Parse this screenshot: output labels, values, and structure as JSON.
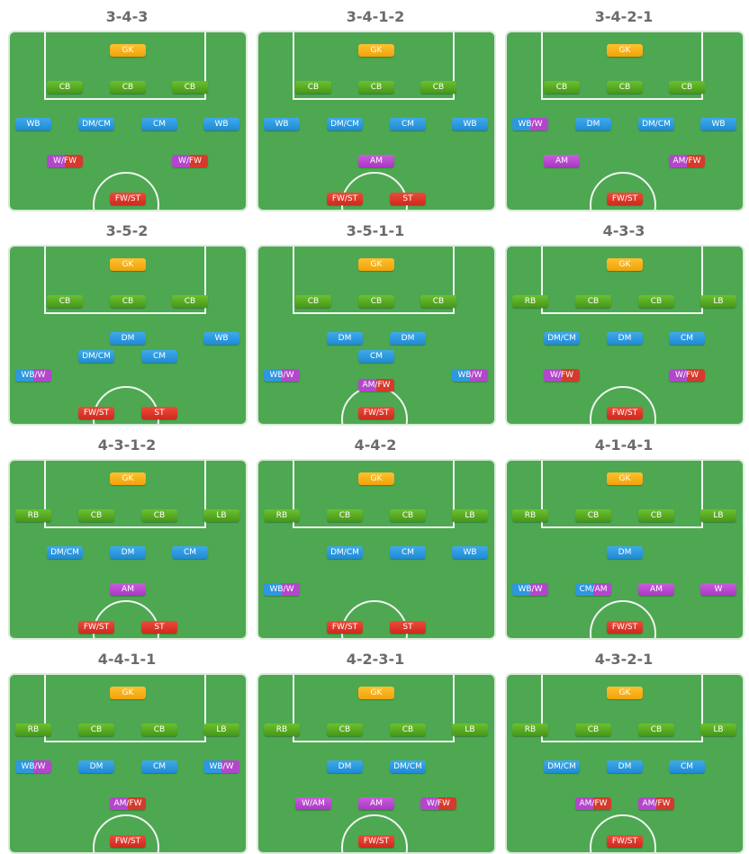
{
  "formations": [
    {
      "name": "3-4-3",
      "positions": [
        {
          "label": "GK",
          "role": "gk"
        },
        {
          "label": "CB",
          "role": "def"
        },
        {
          "label": "CB",
          "role": "def"
        },
        {
          "label": "CB",
          "role": "def"
        },
        {
          "label": "WB",
          "role": "mid"
        },
        {
          "label": "DM/CM",
          "role": "mid"
        },
        {
          "label": "CM",
          "role": "mid"
        },
        {
          "label": "WB",
          "role": "mid"
        },
        {
          "label": "W/FW",
          "role": "att-fwd"
        },
        {
          "label": "W/FW",
          "role": "att-fwd"
        },
        {
          "label": "FW/ST",
          "role": "fwd"
        }
      ]
    },
    {
      "name": "3-4-1-2",
      "positions": [
        {
          "label": "GK",
          "role": "gk"
        },
        {
          "label": "CB",
          "role": "def"
        },
        {
          "label": "CB",
          "role": "def"
        },
        {
          "label": "CB",
          "role": "def"
        },
        {
          "label": "WB",
          "role": "mid"
        },
        {
          "label": "DM/CM",
          "role": "mid"
        },
        {
          "label": "CM",
          "role": "mid"
        },
        {
          "label": "WB",
          "role": "mid"
        },
        {
          "label": "AM",
          "role": "att"
        },
        {
          "label": "FW/ST",
          "role": "fwd"
        },
        {
          "label": "ST",
          "role": "fwd"
        }
      ]
    },
    {
      "name": "3-4-2-1",
      "positions": [
        {
          "label": "GK",
          "role": "gk"
        },
        {
          "label": "CB",
          "role": "def"
        },
        {
          "label": "CB",
          "role": "def"
        },
        {
          "label": "CB",
          "role": "def"
        },
        {
          "label": "WB/W",
          "role": "m-att"
        },
        {
          "label": "DM",
          "role": "mid"
        },
        {
          "label": "DM/CM",
          "role": "mid"
        },
        {
          "label": "WB",
          "role": "mid"
        },
        {
          "label": "AM",
          "role": "att"
        },
        {
          "label": "AM/FW",
          "role": "att-fwd"
        },
        {
          "label": "FW/ST",
          "role": "fwd"
        }
      ]
    },
    {
      "name": "3-5-2",
      "positions": [
        {
          "label": "GK",
          "role": "gk"
        },
        {
          "label": "CB",
          "role": "def"
        },
        {
          "label": "CB",
          "role": "def"
        },
        {
          "label": "CB",
          "role": "def"
        },
        {
          "label": "DM",
          "role": "mid"
        },
        {
          "label": "WB",
          "role": "mid"
        },
        {
          "label": "DM/CM",
          "role": "mid"
        },
        {
          "label": "CM",
          "role": "mid"
        },
        {
          "label": "WB/W",
          "role": "m-att"
        },
        {
          "label": "FW/ST",
          "role": "fwd"
        },
        {
          "label": "ST",
          "role": "fwd"
        }
      ]
    },
    {
      "name": "3-5-1-1",
      "positions": [
        {
          "label": "GK",
          "role": "gk"
        },
        {
          "label": "CB",
          "role": "def"
        },
        {
          "label": "CB",
          "role": "def"
        },
        {
          "label": "CB",
          "role": "def"
        },
        {
          "label": "DM",
          "role": "mid"
        },
        {
          "label": "DM",
          "role": "mid"
        },
        {
          "label": "CM",
          "role": "mid"
        },
        {
          "label": "WB/W",
          "role": "m-att"
        },
        {
          "label": "WB/W",
          "role": "m-att"
        },
        {
          "label": "AM/FW",
          "role": "att-fwd"
        },
        {
          "label": "FW/ST",
          "role": "fwd"
        }
      ]
    },
    {
      "name": "4-3-3",
      "positions": [
        {
          "label": "GK",
          "role": "gk"
        },
        {
          "label": "RB",
          "role": "def"
        },
        {
          "label": "CB",
          "role": "def"
        },
        {
          "label": "CB",
          "role": "def"
        },
        {
          "label": "LB",
          "role": "def"
        },
        {
          "label": "DM/CM",
          "role": "mid"
        },
        {
          "label": "DM",
          "role": "mid"
        },
        {
          "label": "CM",
          "role": "mid"
        },
        {
          "label": "W/FW",
          "role": "att-fwd"
        },
        {
          "label": "W/FW",
          "role": "att-fwd"
        },
        {
          "label": "FW/ST",
          "role": "fwd"
        }
      ]
    },
    {
      "name": "4-3-1-2",
      "positions": [
        {
          "label": "GK",
          "role": "gk"
        },
        {
          "label": "RB",
          "role": "def"
        },
        {
          "label": "CB",
          "role": "def"
        },
        {
          "label": "CB",
          "role": "def"
        },
        {
          "label": "LB",
          "role": "def"
        },
        {
          "label": "DM/CM",
          "role": "mid"
        },
        {
          "label": "DM",
          "role": "mid"
        },
        {
          "label": "CM",
          "role": "mid"
        },
        {
          "label": "AM",
          "role": "att"
        },
        {
          "label": "FW/ST",
          "role": "fwd"
        },
        {
          "label": "ST",
          "role": "fwd"
        }
      ]
    },
    {
      "name": "4-4-2",
      "positions": [
        {
          "label": "GK",
          "role": "gk"
        },
        {
          "label": "RB",
          "role": "def"
        },
        {
          "label": "CB",
          "role": "def"
        },
        {
          "label": "CB",
          "role": "def"
        },
        {
          "label": "LB",
          "role": "def"
        },
        {
          "label": "DM/CM",
          "role": "mid"
        },
        {
          "label": "CM",
          "role": "mid"
        },
        {
          "label": "WB",
          "role": "mid"
        },
        {
          "label": "WB/W",
          "role": "m-att"
        },
        {
          "label": "FW/ST",
          "role": "fwd"
        },
        {
          "label": "ST",
          "role": "fwd"
        }
      ]
    },
    {
      "name": "4-1-4-1",
      "positions": [
        {
          "label": "GK",
          "role": "gk"
        },
        {
          "label": "RB",
          "role": "def"
        },
        {
          "label": "CB",
          "role": "def"
        },
        {
          "label": "CB",
          "role": "def"
        },
        {
          "label": "LB",
          "role": "def"
        },
        {
          "label": "DM",
          "role": "mid"
        },
        {
          "label": "WB/W",
          "role": "m-att"
        },
        {
          "label": "CM/AM",
          "role": "m-att"
        },
        {
          "label": "AM",
          "role": "att"
        },
        {
          "label": "W",
          "role": "att"
        },
        {
          "label": "FW/ST",
          "role": "fwd"
        }
      ]
    },
    {
      "name": "4-4-1-1",
      "positions": [
        {
          "label": "GK",
          "role": "gk"
        },
        {
          "label": "RB",
          "role": "def"
        },
        {
          "label": "CB",
          "role": "def"
        },
        {
          "label": "CB",
          "role": "def"
        },
        {
          "label": "LB",
          "role": "def"
        },
        {
          "label": "WB/W",
          "role": "m-att"
        },
        {
          "label": "DM",
          "role": "mid"
        },
        {
          "label": "CM",
          "role": "mid"
        },
        {
          "label": "WB/W",
          "role": "m-att"
        },
        {
          "label": "AM/FW",
          "role": "att-fwd"
        },
        {
          "label": "FW/ST",
          "role": "fwd"
        }
      ]
    },
    {
      "name": "4-2-3-1",
      "positions": [
        {
          "label": "GK",
          "role": "gk"
        },
        {
          "label": "RB",
          "role": "def"
        },
        {
          "label": "CB",
          "role": "def"
        },
        {
          "label": "CB",
          "role": "def"
        },
        {
          "label": "LB",
          "role": "def"
        },
        {
          "label": "DM",
          "role": "mid"
        },
        {
          "label": "DM/CM",
          "role": "mid"
        },
        {
          "label": "W/AM",
          "role": "att"
        },
        {
          "label": "AM",
          "role": "att"
        },
        {
          "label": "W/FW",
          "role": "att-fwd"
        },
        {
          "label": "FW/ST",
          "role": "fwd"
        }
      ]
    },
    {
      "name": "4-3-2-1",
      "positions": [
        {
          "label": "GK",
          "role": "gk"
        },
        {
          "label": "RB",
          "role": "def"
        },
        {
          "label": "CB",
          "role": "def"
        },
        {
          "label": "CB",
          "role": "def"
        },
        {
          "label": "LB",
          "role": "def"
        },
        {
          "label": "DM/CM",
          "role": "mid"
        },
        {
          "label": "DM",
          "role": "mid"
        },
        {
          "label": "CM",
          "role": "mid"
        },
        {
          "label": "AM/FW",
          "role": "att-fwd"
        },
        {
          "label": "AM/FW",
          "role": "att-fwd"
        },
        {
          "label": "FW/ST",
          "role": "fwd"
        }
      ]
    }
  ]
}
